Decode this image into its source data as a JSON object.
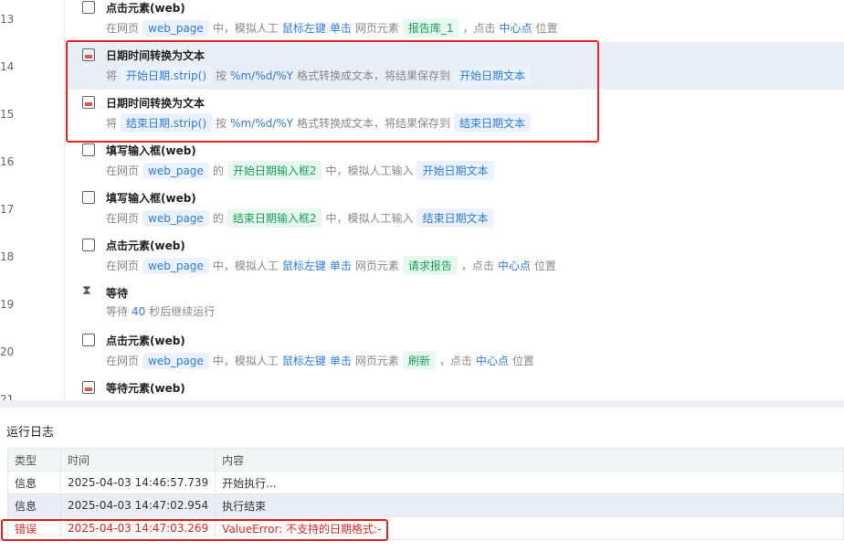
{
  "steps": [
    {
      "num": "13",
      "title": "点击元素(web)",
      "icon": "click-icon",
      "parts": [
        [
          "t",
          "在网页"
        ],
        [
          "v",
          "web_page"
        ],
        [
          "t",
          "中，模拟人工"
        ],
        [
          "k",
          "鼠标左键"
        ],
        [
          "k",
          "单击"
        ],
        [
          "t",
          "网页元素"
        ],
        [
          "e",
          "报告库_1"
        ],
        [
          "t",
          "，点击"
        ],
        [
          "k",
          "中心点"
        ],
        [
          "t",
          "位置"
        ]
      ]
    },
    {
      "num": "14",
      "title": "日期时间转换为文本",
      "icon": "calendar-icon",
      "parts": [
        [
          "t",
          "将"
        ],
        [
          "v",
          "开始日期.strip()"
        ],
        [
          "t",
          "按"
        ],
        [
          "k",
          "%m/%d/%Y"
        ],
        [
          "t",
          "格式转换成文本，将结果保存到"
        ],
        [
          "v",
          "开始日期文本"
        ]
      ]
    },
    {
      "num": "15",
      "title": "日期时间转换为文本",
      "icon": "calendar-icon",
      "parts": [
        [
          "t",
          "将"
        ],
        [
          "v",
          "结束日期.strip()"
        ],
        [
          "t",
          "按"
        ],
        [
          "k",
          "%m/%d/%Y"
        ],
        [
          "t",
          "格式转换成文本，将结果保存到"
        ],
        [
          "v",
          "结束日期文本"
        ]
      ]
    },
    {
      "num": "16",
      "title": "填写输入框(web)",
      "icon": "input-icon",
      "parts": [
        [
          "t",
          "在网页"
        ],
        [
          "v",
          "web_page"
        ],
        [
          "t",
          "的"
        ],
        [
          "e",
          "开始日期输入框2"
        ],
        [
          "t",
          "中，模拟人工输入"
        ],
        [
          "v",
          "开始日期文本"
        ]
      ]
    },
    {
      "num": "17",
      "title": "填写输入框(web)",
      "icon": "input-icon",
      "parts": [
        [
          "t",
          "在网页"
        ],
        [
          "v",
          "web_page"
        ],
        [
          "t",
          "的"
        ],
        [
          "e",
          "结束日期输入框2"
        ],
        [
          "t",
          "中，模拟人工输入"
        ],
        [
          "v",
          "结束日期文本"
        ]
      ]
    },
    {
      "num": "18",
      "title": "点击元素(web)",
      "icon": "click-icon",
      "parts": [
        [
          "t",
          "在网页"
        ],
        [
          "v",
          "web_page"
        ],
        [
          "t",
          "中，模拟人工"
        ],
        [
          "k",
          "鼠标左键"
        ],
        [
          "k",
          "单击"
        ],
        [
          "t",
          "网页元素"
        ],
        [
          "e",
          "请求报告"
        ],
        [
          "t",
          "，点击"
        ],
        [
          "k",
          "中心点"
        ],
        [
          "t",
          "位置"
        ]
      ]
    },
    {
      "num": "19",
      "title": "等待",
      "icon": "hourglass-icon",
      "parts": [
        [
          "t",
          "等待"
        ],
        [
          "k",
          "40"
        ],
        [
          "t",
          "秒后继续运行"
        ]
      ]
    },
    {
      "num": "20",
      "title": "点击元素(web)",
      "icon": "click-icon",
      "parts": [
        [
          "t",
          "在网页"
        ],
        [
          "v",
          "web_page"
        ],
        [
          "t",
          "中，模拟人工"
        ],
        [
          "k",
          "鼠标左键"
        ],
        [
          "k",
          "单击"
        ],
        [
          "t",
          "网页元素"
        ],
        [
          "e",
          "刷新"
        ],
        [
          "t",
          "，点击"
        ],
        [
          "k",
          "中心点"
        ],
        [
          "t",
          "位置"
        ]
      ]
    },
    {
      "num": "21",
      "title": "等待元素(web)",
      "icon": "wait-element-icon",
      "parts": []
    }
  ],
  "selected_step": "14",
  "log": {
    "title": "运行日志",
    "headers": [
      "类型",
      "时间",
      "内容"
    ],
    "rows": [
      [
        "信息",
        "2025-04-03 14:46:57.739",
        "开始执行..."
      ],
      [
        "信息",
        "2025-04-03 14:47:02.954",
        "执行结束"
      ],
      [
        "错误",
        "2025-04-03 14:47:03.269",
        "ValueError: 不支持的日期格式:-"
      ]
    ]
  }
}
